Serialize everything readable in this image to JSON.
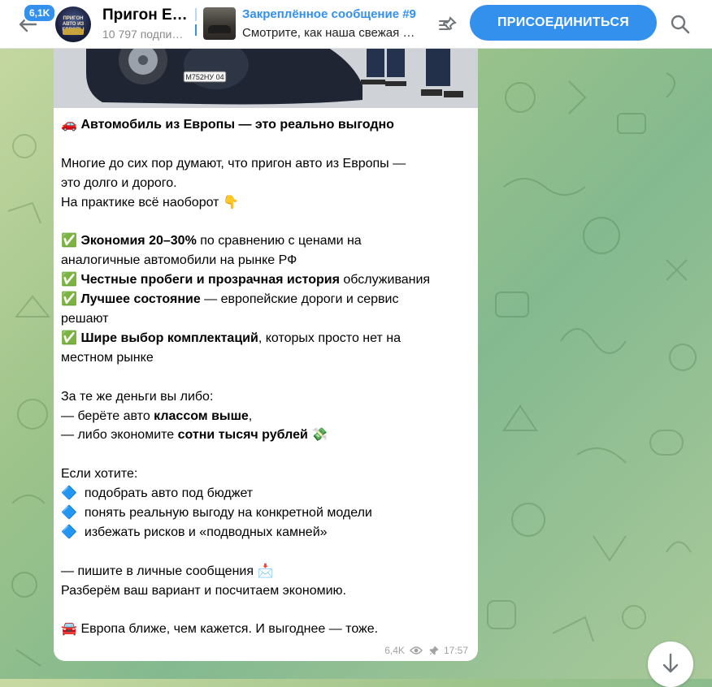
{
  "header": {
    "unread_count": "6,1K",
    "channel_title": "Пригон Е…",
    "subscribers": "10 797 подпи…",
    "avatar_text": "ПРИГОН АВТО ИЗ ЕВРОПЫ",
    "pinned": {
      "title": "Закреплённое сообщение #9",
      "text": "Смотрите, как наша свежая …"
    },
    "join_label": "ПРИСОЕДИНИТЬСЯ",
    "accent_color": "#3390ec"
  },
  "message": {
    "photo_plate": "М752НУ",
    "lines": [
      {
        "emoji": "🚗",
        "parts": [
          {
            "t": " "
          },
          {
            "t": "Автомобиль из Европы — это реально выгодно",
            "b": true
          }
        ]
      },
      {
        "parts": []
      },
      {
        "parts": [
          {
            "t": "Многие до сих пор думают, что пригон авто из Европы —"
          }
        ]
      },
      {
        "parts": [
          {
            "t": "это долго и дорого."
          }
        ]
      },
      {
        "parts": [
          {
            "t": "На практике всё наоборот "
          }
        ],
        "emoji_end": "👇"
      },
      {
        "parts": []
      },
      {
        "emoji": "✅",
        "parts": [
          {
            "t": " "
          },
          {
            "t": "Экономия 20–30%",
            "b": true
          },
          {
            "t": " по сравнению с ценами на"
          }
        ]
      },
      {
        "parts": [
          {
            "t": "аналогичные автомобили на рынке РФ"
          }
        ]
      },
      {
        "emoji": "✅",
        "parts": [
          {
            "t": " "
          },
          {
            "t": "Честные пробеги и прозрачная история",
            "b": true
          },
          {
            "t": " обслуживания"
          }
        ]
      },
      {
        "emoji": "✅",
        "parts": [
          {
            "t": " "
          },
          {
            "t": "Лучшее состояние",
            "b": true
          },
          {
            "t": " — европейские дороги и сервис"
          }
        ]
      },
      {
        "parts": [
          {
            "t": "решают"
          }
        ]
      },
      {
        "emoji": "✅",
        "parts": [
          {
            "t": " "
          },
          {
            "t": "Шире выбор комплектаций",
            "b": true
          },
          {
            "t": ", которых просто нет на"
          }
        ]
      },
      {
        "parts": [
          {
            "t": "местном рынке"
          }
        ]
      },
      {
        "parts": []
      },
      {
        "parts": [
          {
            "t": "За те же деньги вы либо:"
          }
        ]
      },
      {
        "parts": [
          {
            "t": "— берёте авто "
          },
          {
            "t": "классом выше",
            "b": true
          },
          {
            "t": ","
          }
        ]
      },
      {
        "parts": [
          {
            "t": "— либо экономите "
          },
          {
            "t": "сотни тысяч рублей",
            "b": true
          },
          {
            "t": " "
          }
        ],
        "emoji_end": "💸"
      },
      {
        "parts": []
      },
      {
        "parts": [
          {
            "t": "Если хотите:"
          }
        ]
      },
      {
        "emoji": "🔷",
        "parts": [
          {
            "t": "  подобрать авто под бюджет"
          }
        ]
      },
      {
        "emoji": "🔷",
        "parts": [
          {
            "t": "  понять реальную выгоду на конкретной модели"
          }
        ]
      },
      {
        "emoji": "🔷",
        "parts": [
          {
            "t": "  избежать рисков и «подводных камней»"
          }
        ]
      },
      {
        "parts": []
      },
      {
        "parts": [
          {
            "t": "— пишите в личные сообщения "
          }
        ],
        "emoji_end": "📩"
      },
      {
        "parts": [
          {
            "t": "Разберём ваш вариант и посчитаем экономию."
          }
        ]
      },
      {
        "parts": []
      },
      {
        "emoji": "🚘",
        "parts": [
          {
            "t": " Европа ближе, чем кажется. И выгоднее — тоже."
          }
        ]
      }
    ],
    "views": "6,4K",
    "time": "17:57"
  }
}
